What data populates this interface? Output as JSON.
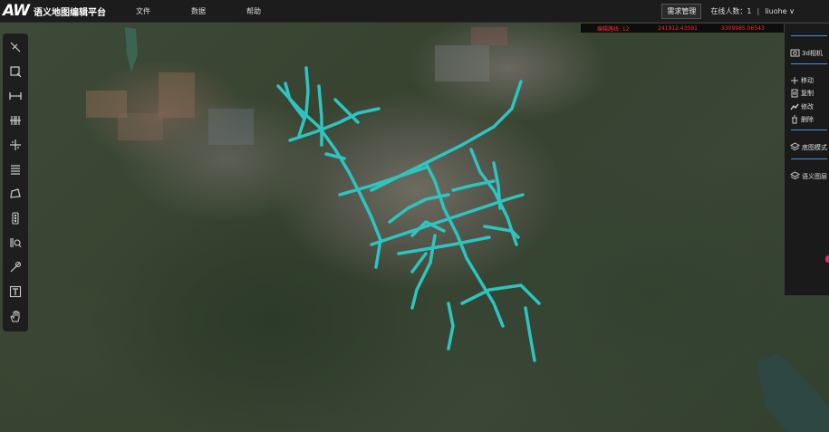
{
  "header": {
    "logo_text": "AW",
    "app_title": "语义地图编辑平台",
    "menu": [
      "文件",
      "数据",
      "帮助"
    ],
    "request_button": "需求管理",
    "online_label": "在线人数：1",
    "separator": "|",
    "user_name": "liuohe"
  },
  "status_bar": {
    "road_count": "编辑路线: 12",
    "coord_x": "241912.43591",
    "coord_y": "3309985.06543"
  },
  "toolbar": {
    "tools": [
      "select-line-icon",
      "select-box-icon",
      "horizontal-measure-icon",
      "vertical-bars-icon",
      "split-icon",
      "list-icon",
      "polygon-icon",
      "traffic-light-icon",
      "zoom-layer-icon",
      "pin-route-icon",
      "text-icon",
      "hand-icon"
    ]
  },
  "right_panel": {
    "camera_label": "3d相机",
    "actions": [
      "移动",
      "复制",
      "修改",
      "删除"
    ],
    "base_mode_label": "底图模式",
    "semantic_layer_label": "语义图层"
  },
  "colors": {
    "road": "#2ec4c0",
    "status_text": "#ff2b2b",
    "accent_line": "#4a8fd6"
  }
}
